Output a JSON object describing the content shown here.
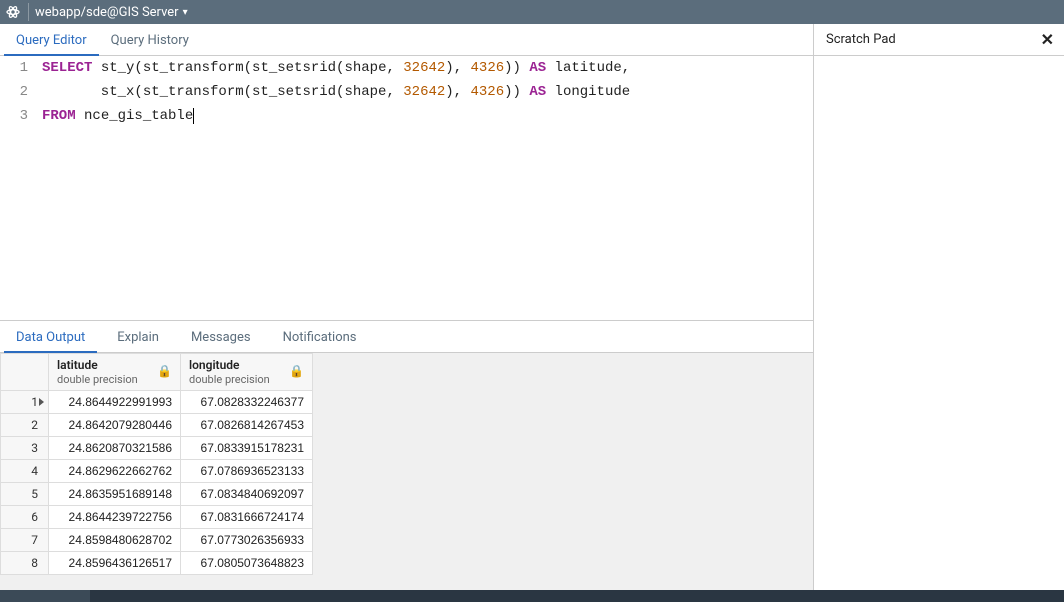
{
  "titlebar": {
    "text": "webapp/sde@GIS Server"
  },
  "editorTabs": {
    "queryEditor": "Query Editor",
    "queryHistory": "Query History"
  },
  "sql": {
    "lines": [
      {
        "n": "1",
        "pre": "",
        "kw1": "SELECT",
        "mid1": " st_y(st_transform(st_setsrid(shape, ",
        "srid1": "32642",
        "mid2": "), ",
        "srid2": "4326",
        "mid3": ")) ",
        "kw2": "AS",
        "post": " latitude,"
      },
      {
        "n": "2",
        "pre": "       st_x(st_transform(st_setsrid(shape, ",
        "srid1": "32642",
        "mid2": "), ",
        "srid2": "4326",
        "mid3": ")) ",
        "kw2": "AS",
        "post": " longitude"
      },
      {
        "n": "3",
        "kw1": "FROM",
        "post": " nce_gis_table"
      }
    ]
  },
  "resultTabs": {
    "dataOutput": "Data Output",
    "explain": "Explain",
    "messages": "Messages",
    "notifications": "Notifications"
  },
  "columns": [
    {
      "name": "latitude",
      "type": "double precision"
    },
    {
      "name": "longitude",
      "type": "double precision"
    }
  ],
  "rows": [
    {
      "n": "1",
      "lat": "24.8644922991993",
      "lon": "67.0828332246377"
    },
    {
      "n": "2",
      "lat": "24.8642079280446",
      "lon": "67.0826814267453"
    },
    {
      "n": "3",
      "lat": "24.8620870321586",
      "lon": "67.0833915178231"
    },
    {
      "n": "4",
      "lat": "24.8629622662762",
      "lon": "67.0786936523133"
    },
    {
      "n": "5",
      "lat": "24.8635951689148",
      "lon": "67.0834840692097"
    },
    {
      "n": "6",
      "lat": "24.8644239722756",
      "lon": "67.0831666724174"
    },
    {
      "n": "7",
      "lat": "24.8598480628702",
      "lon": "67.0773026356933"
    },
    {
      "n": "8",
      "lat": "24.8596436126517",
      "lon": "67.0805073648823"
    }
  ],
  "scratch": {
    "title": "Scratch Pad"
  }
}
